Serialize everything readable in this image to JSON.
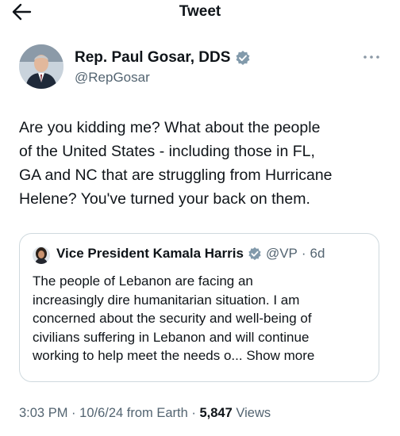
{
  "header": {
    "title": "Tweet",
    "back_icon": "arrow-left-icon"
  },
  "author": {
    "name": "Rep. Paul Gosar, DDS",
    "handle": "@RepGosar",
    "verified_icon": "verified-badge-icon",
    "more_icon": "more-dots-icon"
  },
  "tweet": {
    "lines": [
      "Are you kidding me?  What about the people",
      "of the United States - including those in FL,",
      "GA and NC that are struggling from Hurricane",
      "Helene?  You've turned your back on them."
    ]
  },
  "quote": {
    "name": "Vice President Kamala Harris",
    "handle": "@VP",
    "separator": "·",
    "age": "6d",
    "lines": [
      "The people of Lebanon are facing an",
      "increasingly dire humanitarian situation. I am",
      "concerned about the security and well-being of",
      "civilians suffering in Lebanon and will continue",
      "working to help meet the needs o..."
    ],
    "show_more": "Show more"
  },
  "meta": {
    "time": "3:03 PM",
    "sep1": "·",
    "date": "10/6/24 from Earth",
    "sep2": "·",
    "views_count": "5,847",
    "views_label": "Views"
  },
  "colors": {
    "verified": "#829aab",
    "secondary_text": "#536471",
    "border": "#cfd9de"
  }
}
